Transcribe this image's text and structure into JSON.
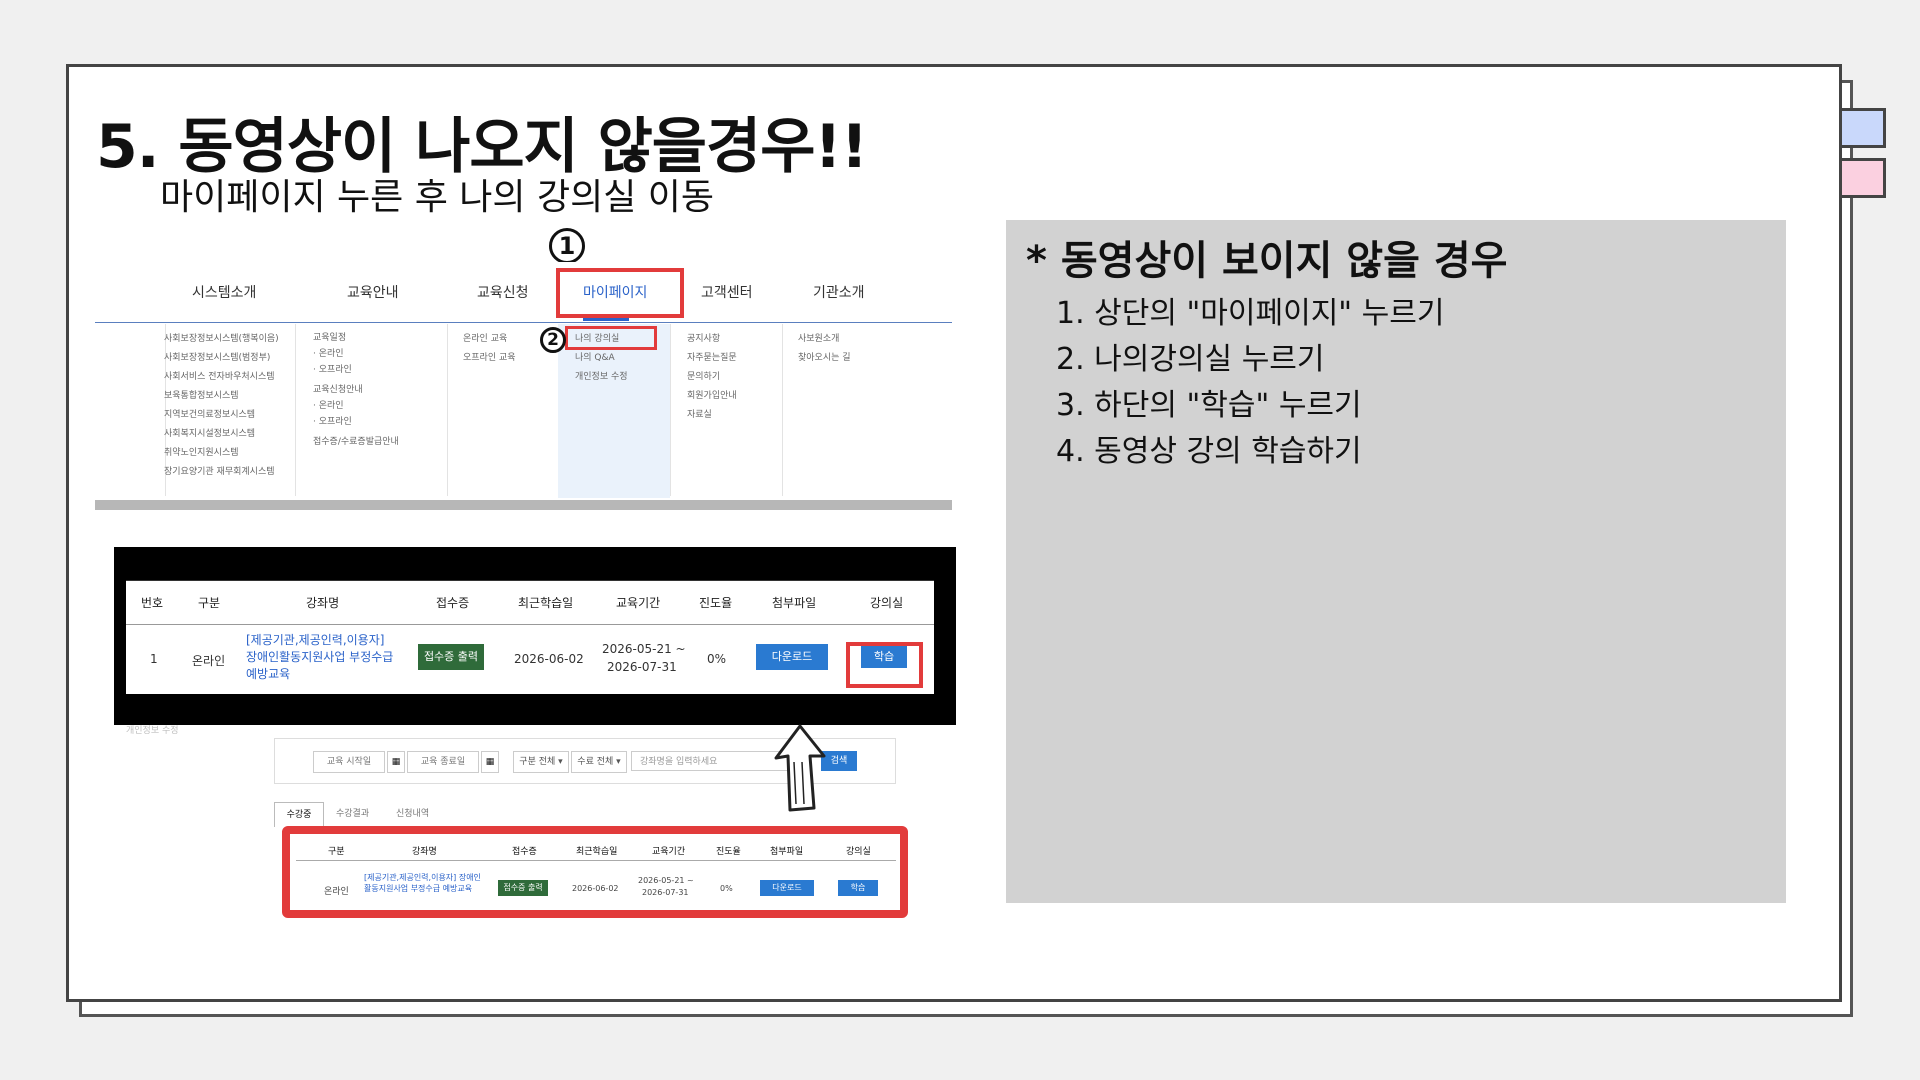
{
  "slide": {
    "title": "5. 동영상이 나오지 않을경우!!",
    "subtitle": "마이페이지 누른 후 나의 강의실 이동"
  },
  "markers": {
    "step1": "1",
    "step2": "2"
  },
  "nav": {
    "items": [
      "시스템소개",
      "교육안내",
      "교육신청",
      "마이페이지",
      "고객센터",
      "기관소개"
    ],
    "dropdown": {
      "system": [
        "사회보장정보시스템(행복이음)",
        "사회보장정보시스템(범정부)",
        "사회서비스 전자바우처시스템",
        "보육통합정보시스템",
        "지역보건의료정보시스템",
        "사회복지시설정보시스템",
        "취약노인지원시스템",
        "장기요양기관 재무회계시스템"
      ],
      "education_info": [
        "교육일정",
        "· 온라인",
        "· 오프라인",
        "교육신청안내",
        "· 온라인",
        "· 오프라인",
        "접수증/수료증발급안내"
      ],
      "education_apply": [
        "온라인 교육",
        "오프라인 교육"
      ],
      "mypage": [
        "나의 강의실",
        "나의 Q&A",
        "개인정보 수정"
      ],
      "support": [
        "공지사항",
        "자주묻는질문",
        "문의하기",
        "회원가입안내",
        "자료실"
      ],
      "about": [
        "사보원소개",
        "찾아오시는 길"
      ]
    }
  },
  "lecture_table": {
    "headers": [
      "번호",
      "구분",
      "강좌명",
      "접수증",
      "최근학습일",
      "교육기간",
      "진도율",
      "첨부파일",
      "강의실"
    ],
    "row": {
      "no": "1",
      "type": "온라인",
      "course": "[제공기관,제공인력,이용자] 장애인활동지원사업 부정수급 예방교육",
      "receipt_btn": "접수증 출력",
      "last_study": "2026-06-02",
      "period_start": "2026-05-21 ~",
      "period_end": "2026-07-31",
      "progress": "0%",
      "download_btn": "다운로드",
      "study_btn": "학습"
    }
  },
  "search_bar": {
    "start_date": "교육 시작일",
    "end_date": "교육 종료일",
    "type_select": "구분 전체",
    "complete_select": "수료 전체",
    "keyword_placeholder": "강좌명을 입력하세요",
    "search_btn": "검색"
  },
  "tabs": [
    "수강중",
    "수강결과",
    "신청내역"
  ],
  "lower_table": {
    "headers": [
      "구분",
      "강좌명",
      "접수증",
      "최근학습일",
      "교육기간",
      "진도율",
      "첨부파일",
      "강의실"
    ],
    "row": {
      "type": "온라인",
      "course": "[제공기관,제공인력,이용자] 장애인활동지원사업 부정수급 예방교육",
      "receipt_btn": "접수증 출력",
      "last_study": "2026-06-02",
      "period_start": "2026-05-21 ~",
      "period_end": "2026-07-31",
      "progress": "0%",
      "download_btn": "다운로드",
      "study_btn": "학습"
    }
  },
  "side_label": "개인정보 수정",
  "panel": {
    "title": "* 동영상이 보이지 않을 경우",
    "steps": [
      "1. 상단의 \"마이페이지\" 누르기",
      "2. 나의강의실 누르기",
      "3. 하단의 \"학습\" 누르기",
      "4. 동영상 강의 학습하기"
    ]
  }
}
